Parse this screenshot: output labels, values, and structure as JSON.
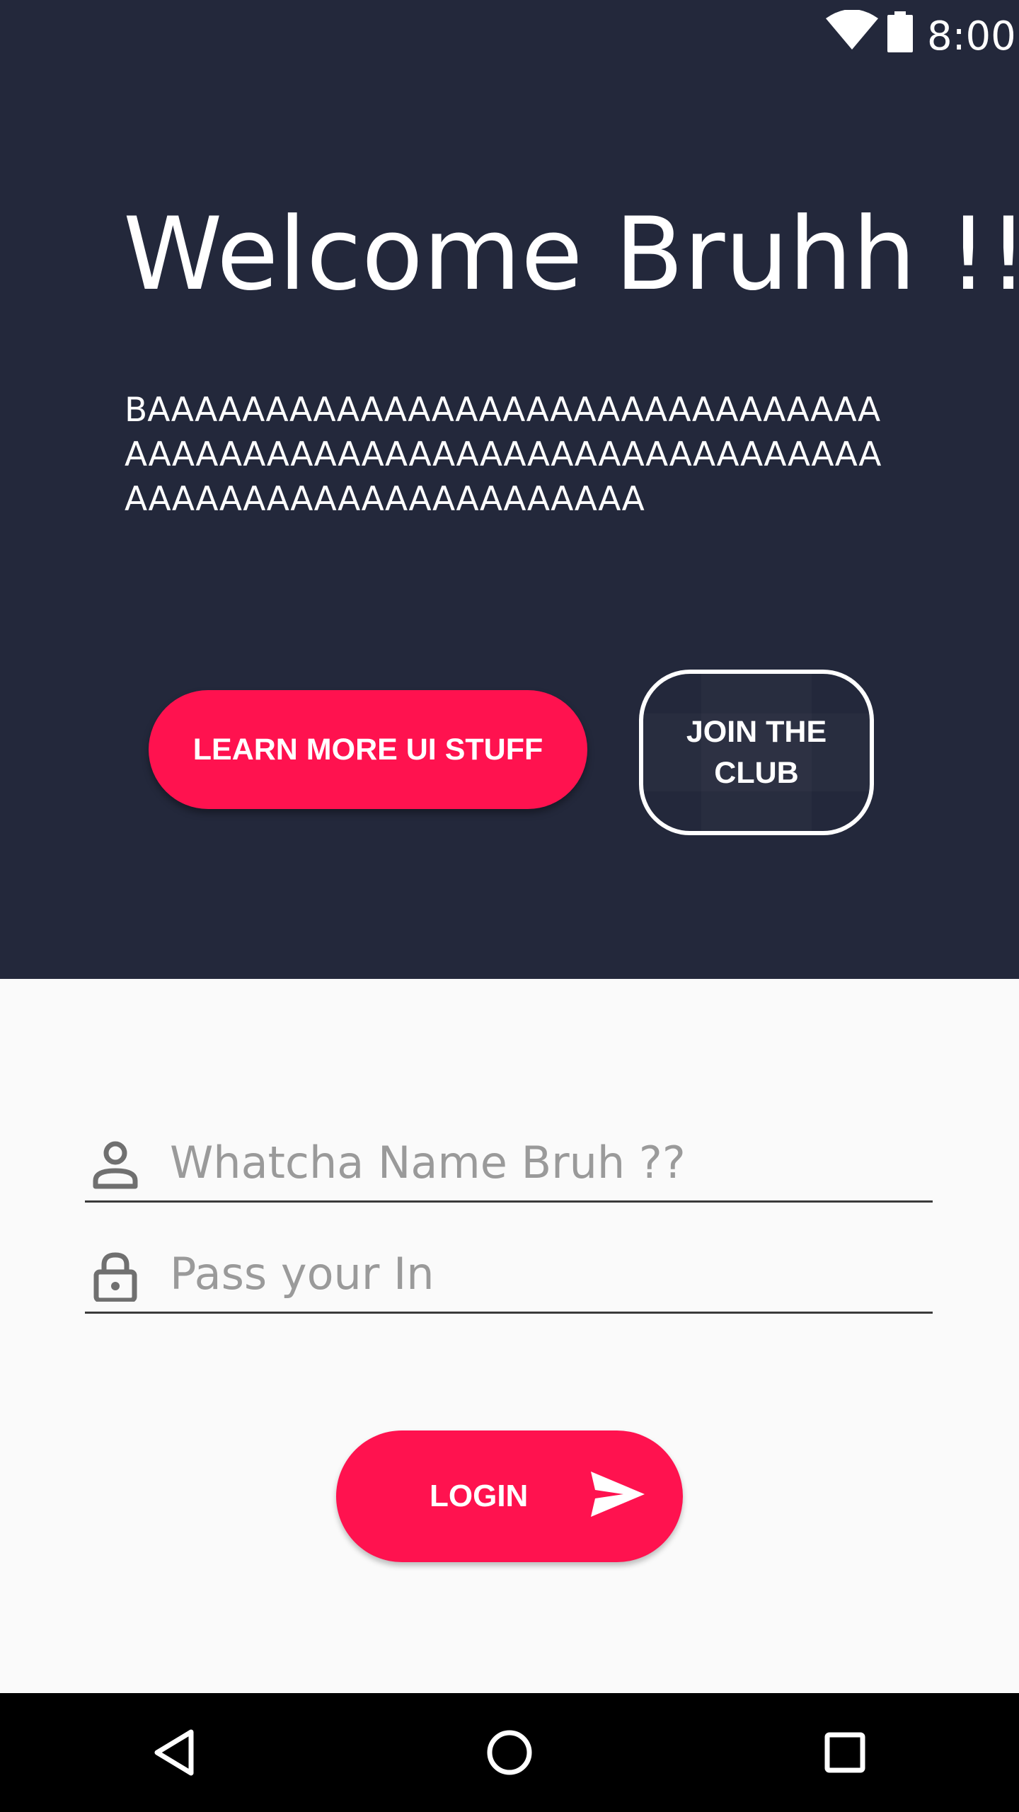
{
  "status_bar": {
    "time": "8:00",
    "wifi_icon": "wifi-icon",
    "battery_icon": "battery-icon"
  },
  "hero": {
    "title": "Welcome Bruhh !!",
    "body": "BAAAAAAAAAAAAAAAAAAAAAAAAAAAAAAAAAAAAAAAAAAAAAAAAAAAAAAAAAAAAAAAAAAAAAAAAAAAAAAAAAAAAA",
    "background_color": "#23283b"
  },
  "buttons": {
    "learn_more": "LEARN MORE UI STUFF",
    "join_club": "JOIN THE CLUB"
  },
  "login_form": {
    "name_placeholder": "Whatcha Name Bruh ??",
    "password_placeholder": "Pass your In",
    "name_icon": "person-icon",
    "password_icon": "lock-icon",
    "submit_label": "LOGIN",
    "submit_icon": "send-icon"
  },
  "nav_bar": {
    "back_icon": "back-triangle-icon",
    "home_icon": "home-circle-icon",
    "recents_icon": "recents-square-icon"
  },
  "colors": {
    "accent": "#ff124f",
    "form_background": "#fafafa"
  }
}
